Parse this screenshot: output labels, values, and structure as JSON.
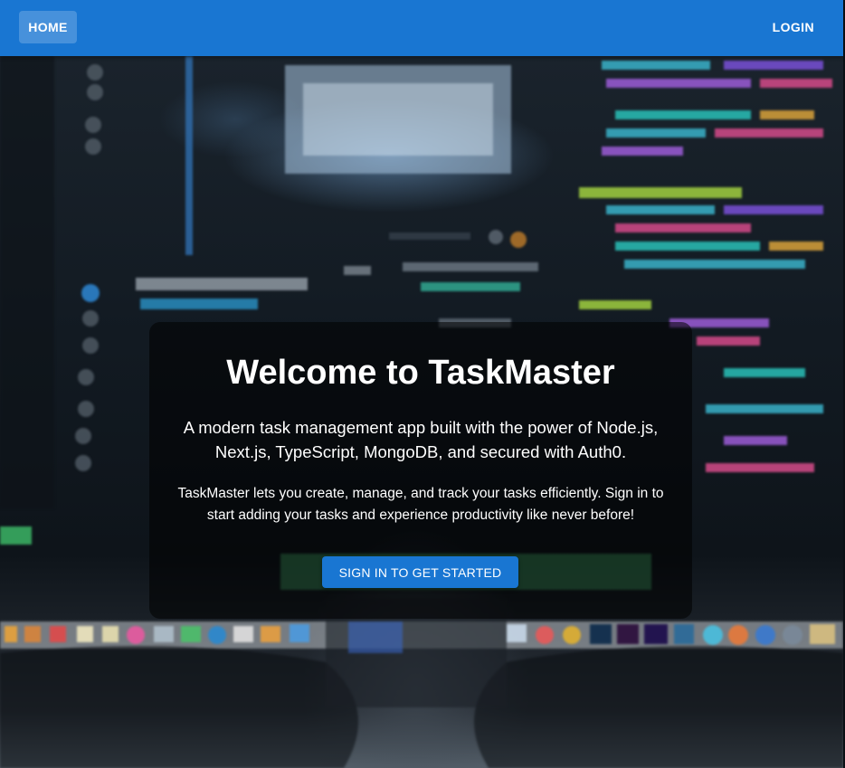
{
  "navbar": {
    "home_label": "HOME",
    "login_label": "LOGIN"
  },
  "hero": {
    "title": "Welcome to TaskMaster",
    "subtitle": "A modern task management app built with the power of Node.js, Next.js, TypeScript, MongoDB, and secured with Auth0.",
    "description": "TaskMaster lets you create, manage, and track your tasks efficiently. Sign in to start adding your tasks and experience productivity like never before!",
    "cta_label": "SIGN IN TO GET STARTED"
  },
  "colors": {
    "primary": "#1976d2",
    "overlay": "rgba(0,0,0,0.55)",
    "text": "#ffffff"
  }
}
